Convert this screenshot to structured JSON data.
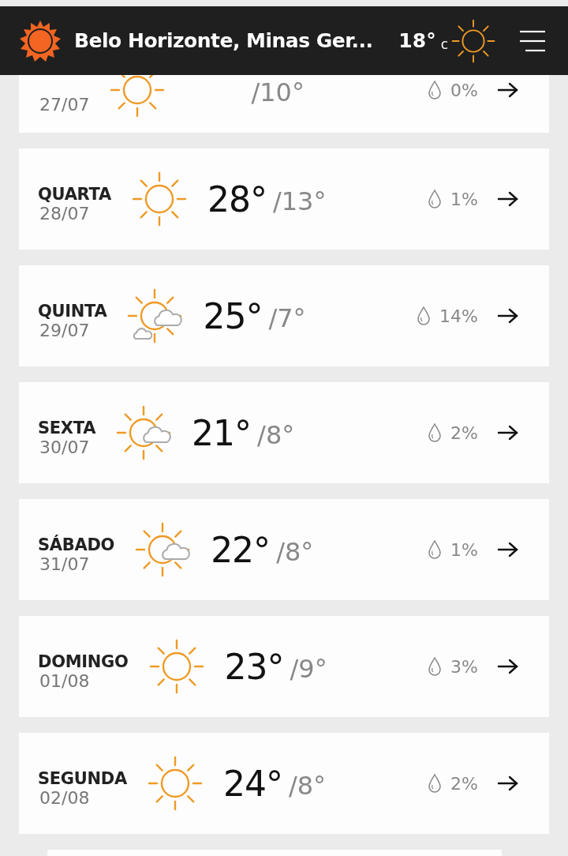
{
  "header": {
    "title": "Belo Horizonte, Minas Ger...",
    "temperature": "18°",
    "unit": "c",
    "kind": "sun"
  },
  "days": [
    {
      "date": "27/07",
      "kind": "sun",
      "low": "/10°",
      "rain": "0%"
    },
    {
      "day": "QUARTA",
      "date": "28/07",
      "kind": "sun",
      "high": "28°",
      "low": "/13°",
      "rain": "1%"
    },
    {
      "day": "QUINTA",
      "date": "29/07",
      "kind": "sunclouds",
      "high": "25°",
      "low": "/7°",
      "rain": "14%"
    },
    {
      "day": "SEXTA",
      "date": "30/07",
      "kind": "suncloud",
      "high": "21°",
      "low": "/8°",
      "rain": "2%"
    },
    {
      "day": "SÁBADO",
      "date": "31/07",
      "kind": "suncloud",
      "high": "22°",
      "low": "/8°",
      "rain": "1%"
    },
    {
      "day": "DOMINGO",
      "date": "01/08",
      "kind": "sun",
      "high": "23°",
      "low": "/9°",
      "rain": "3%"
    },
    {
      "day": "SEGUNDA",
      "date": "02/08",
      "kind": "sun",
      "high": "24°",
      "low": "/8°",
      "rain": "2%"
    }
  ]
}
